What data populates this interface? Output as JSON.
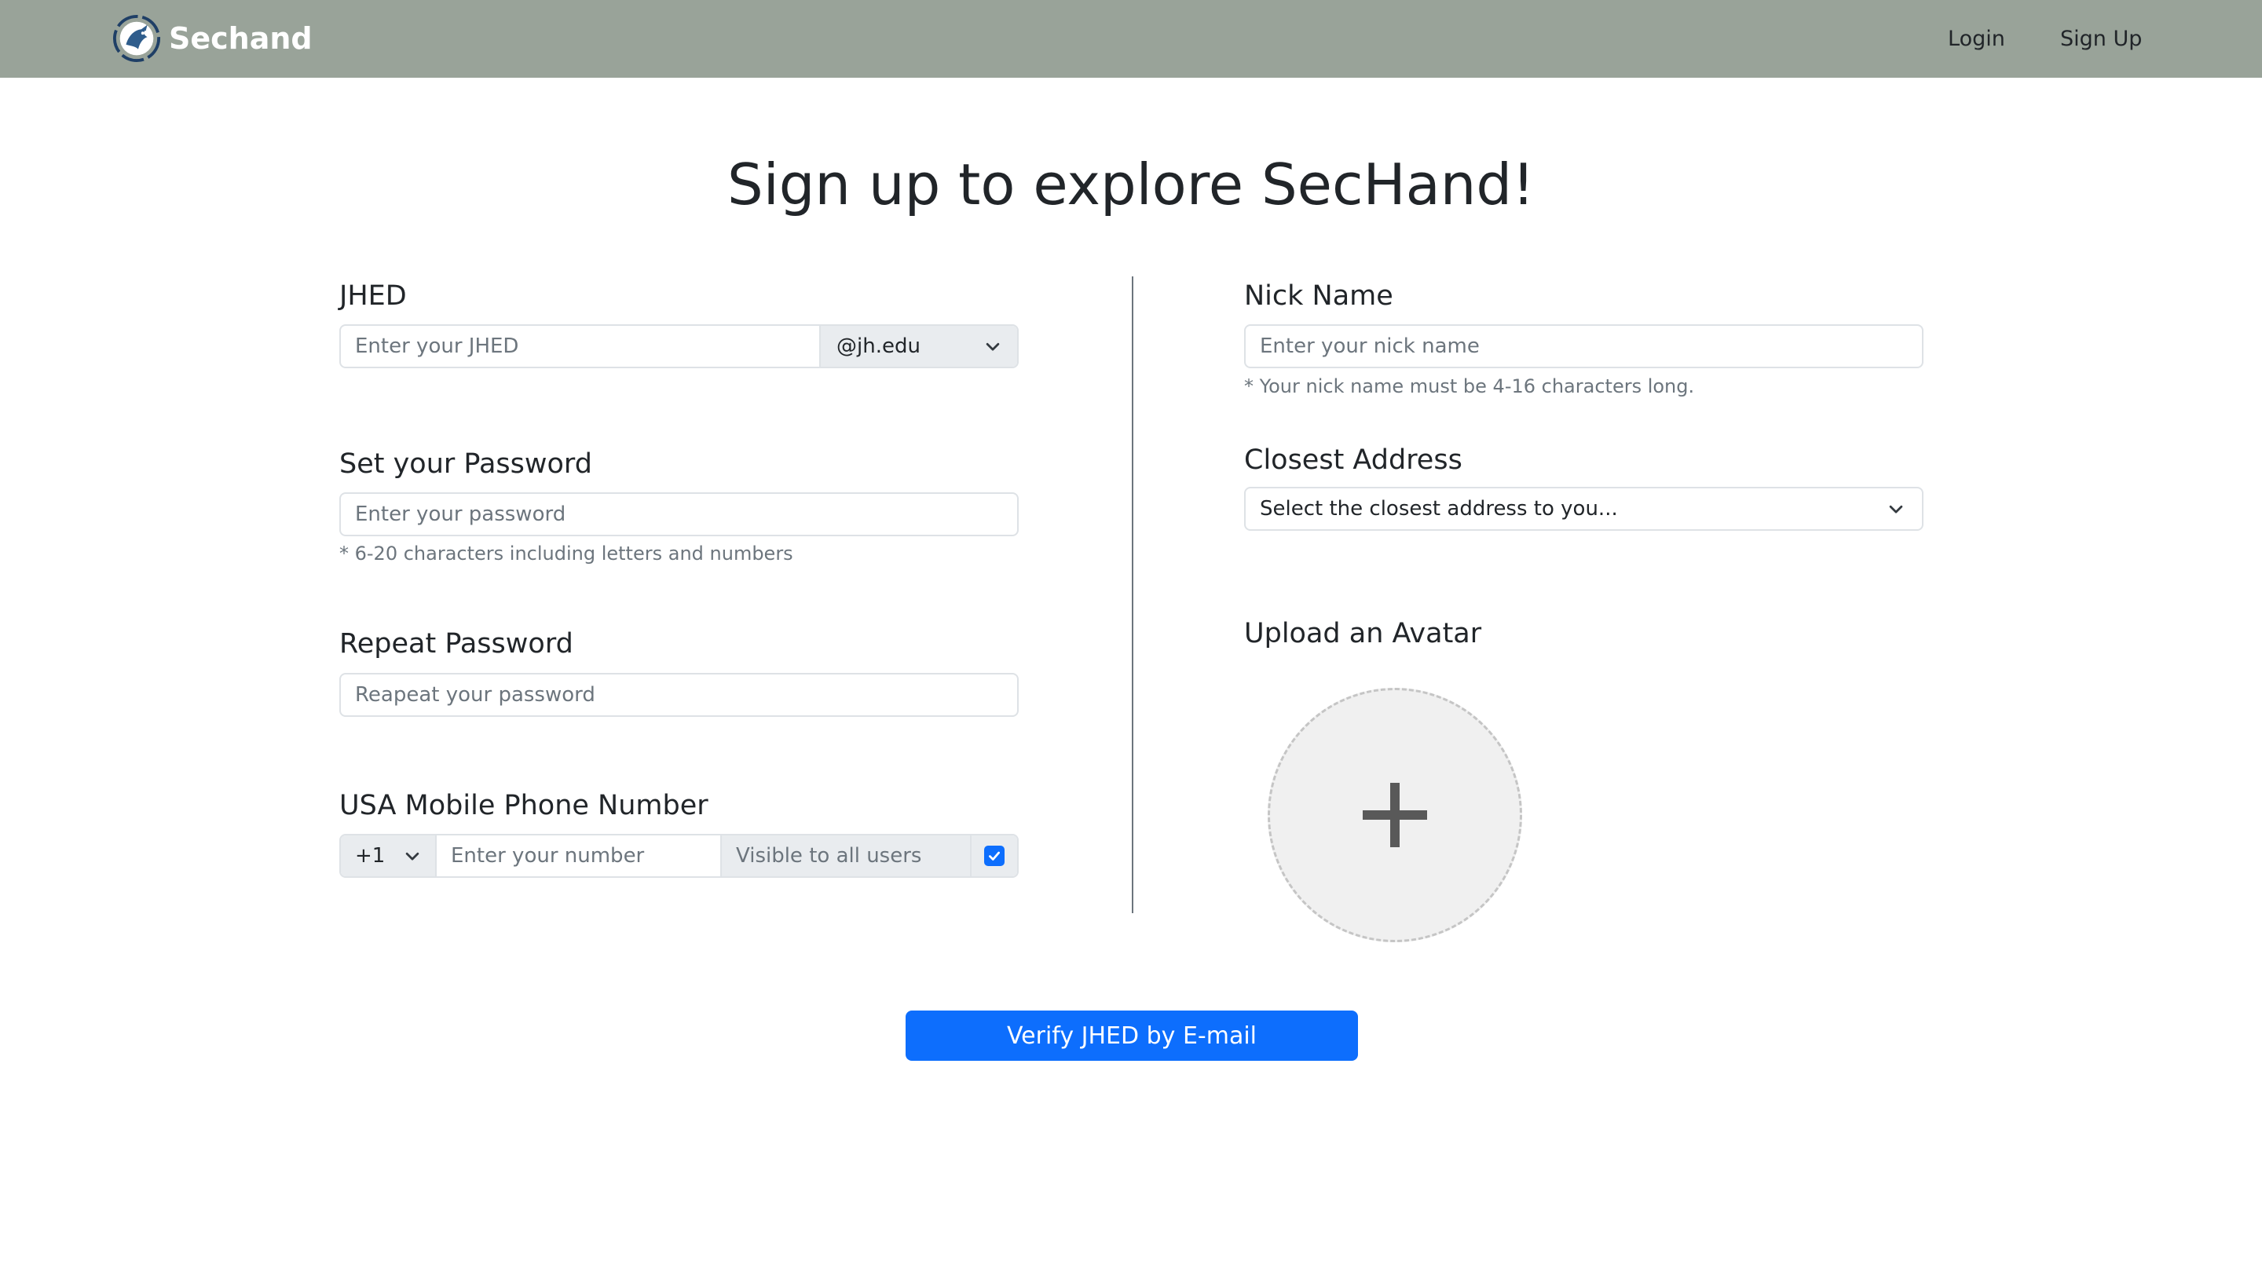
{
  "colors": {
    "navbar": "#99a399",
    "primary": "#0d6efd",
    "muted": "#6c757d"
  },
  "brand": {
    "name": "Sechand",
    "logo_icon": "blue-jay-circle-logo"
  },
  "nav": {
    "login": "Login",
    "signup": "Sign Up"
  },
  "page": {
    "title": "Sign up to explore SecHand!"
  },
  "form": {
    "jhed": {
      "label": "JHED",
      "placeholder": "Enter your JHED",
      "domain": "@jh.edu"
    },
    "password": {
      "label": "Set your Password",
      "placeholder": "Enter your password",
      "help": "* 6-20 characters including letters and numbers"
    },
    "repeat_password": {
      "label": "Repeat Password",
      "placeholder": "Reapeat your password"
    },
    "phone": {
      "label": "USA Mobile Phone Number",
      "country_code": "+1",
      "placeholder": "Enter your number",
      "visible_label": "Visible to all users",
      "visible_checked": true
    },
    "nickname": {
      "label": "Nick Name",
      "placeholder": "Enter your nick name",
      "help": "* Your nick name must be 4-16 characters long."
    },
    "address": {
      "label": "Closest Address",
      "placeholder": "Select the closest address to you..."
    },
    "avatar": {
      "label": "Upload an Avatar",
      "icon": "plus-icon"
    },
    "submit": "Verify JHED by E-mail"
  }
}
